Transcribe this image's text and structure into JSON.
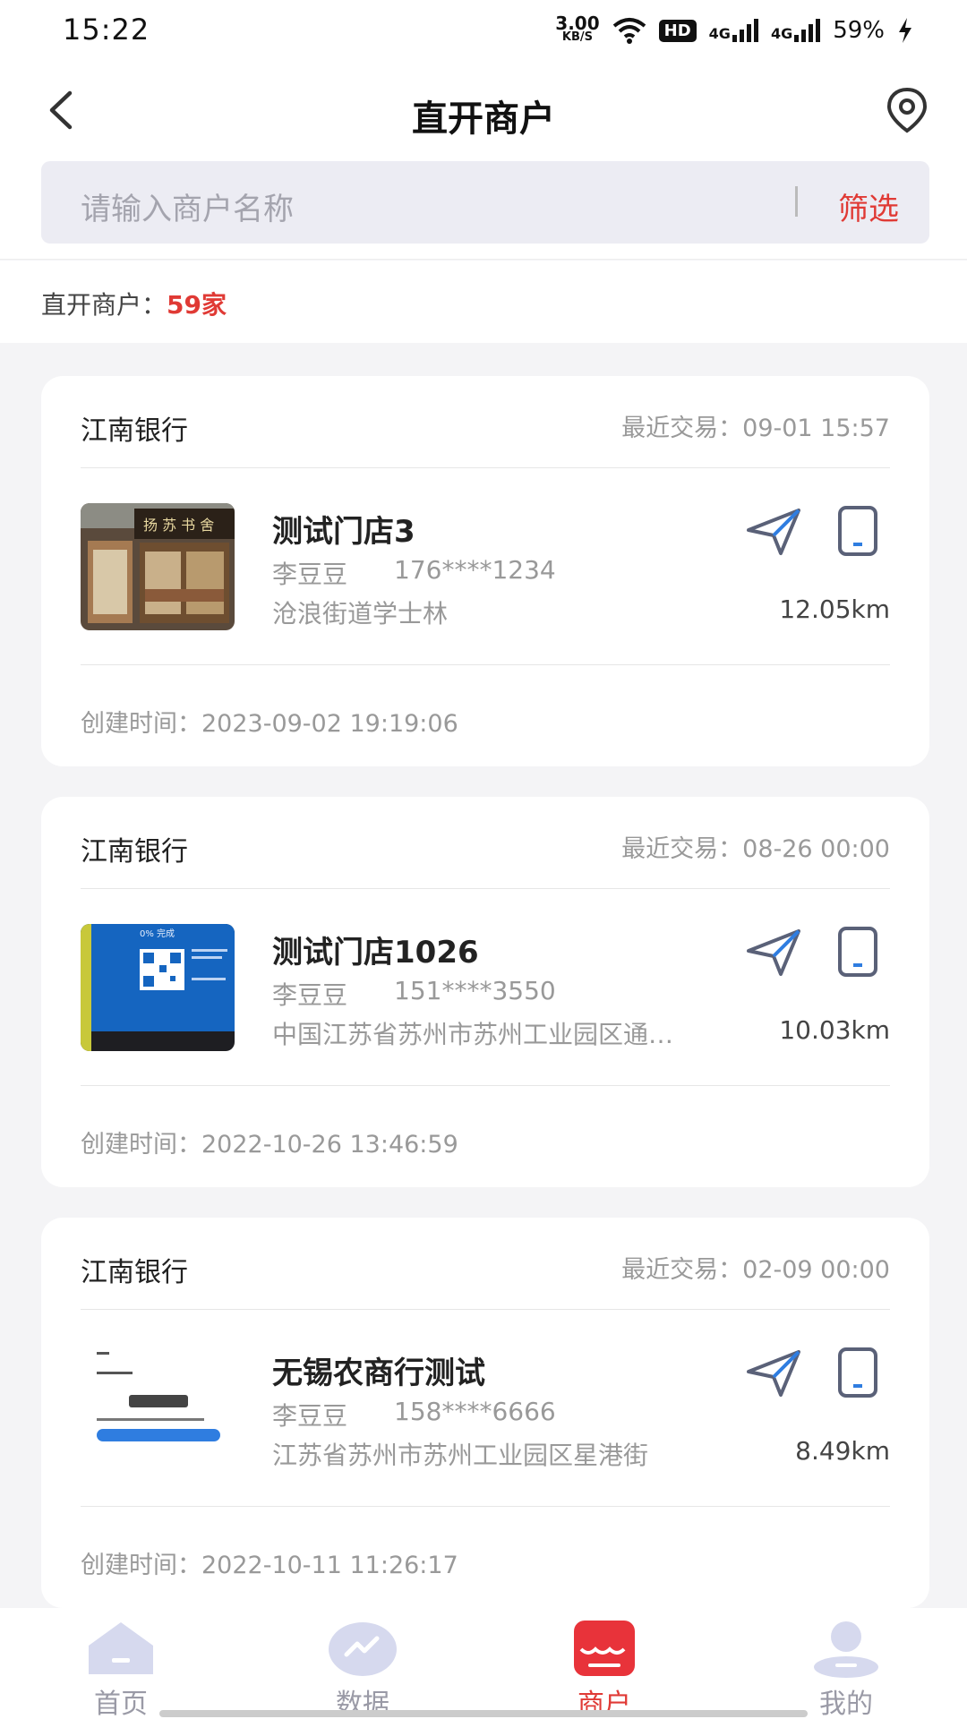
{
  "status_bar": {
    "time": "15:22",
    "speed_value": "3.00",
    "speed_unit": "KB/S",
    "hd": "HD",
    "net1": "4G",
    "net2": "4G",
    "battery": "59%"
  },
  "header": {
    "title": "直开商户",
    "back_icon": "chevron-left-icon",
    "location_icon": "location-pin-icon"
  },
  "search": {
    "placeholder": "请输入商户名称",
    "filter_label": "筛选"
  },
  "summary": {
    "label": "直开商户：",
    "count": "59家"
  },
  "merchants": [
    {
      "bank": "江南银行",
      "recent_label": "最近交易：",
      "recent_time": "09-01 15:57",
      "name": "测试门店3",
      "contact": "李豆豆",
      "phone": "176****1234",
      "address": "沧浪街道学士林",
      "distance": "12.05km",
      "created_label": "创建时间：",
      "created_time": "2023-09-02 19:19:06"
    },
    {
      "bank": "江南银行",
      "recent_label": "最近交易：",
      "recent_time": "08-26 00:00",
      "name": "测试门店1026",
      "contact": "李豆豆",
      "phone": "151****3550",
      "address": "中国江苏省苏州市苏州工业园区通…",
      "distance": "10.03km",
      "created_label": "创建时间：",
      "created_time": "2022-10-26 13:46:59"
    },
    {
      "bank": "江南银行",
      "recent_label": "最近交易：",
      "recent_time": "02-09 00:00",
      "name": "无锡农商行测试",
      "contact": "李豆豆",
      "phone": "158****6666",
      "address": "江苏省苏州市苏州工业园区星港街",
      "distance": "8.49km",
      "created_label": "创建时间：",
      "created_time": "2022-10-11 11:26:17"
    }
  ],
  "tabs": [
    {
      "label": "首页",
      "icon": "home-icon"
    },
    {
      "label": "数据",
      "icon": "chart-icon"
    },
    {
      "label": "商户",
      "icon": "store-icon",
      "active": true
    },
    {
      "label": "我的",
      "icon": "user-icon"
    }
  ],
  "colors": {
    "accent": "#e03a35",
    "icon": "#5a6178",
    "background": "#f4f4f6"
  }
}
